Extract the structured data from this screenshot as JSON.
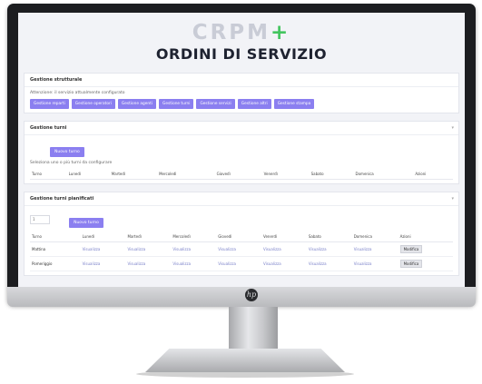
{
  "app": {
    "logo_text": "CRPM",
    "logo_plus": "+",
    "title": "ORDINI DI SERVIZIO"
  },
  "colors": {
    "accent": "#8b7ff0",
    "logo_grey": "#c9ccd6",
    "logo_plus": "#43c55f",
    "title": "#1e2230"
  },
  "section_structure": {
    "heading": "Gestione strutturale",
    "note": "Attenzione: il servizio attualmente configurato",
    "buttons": [
      "Gestione reparti",
      "Gestione operatori",
      "Gestione agenti",
      "Gestione turni",
      "Gestione servizi",
      "Gestione altri",
      "Gestione stampa"
    ]
  },
  "section_shifts": {
    "heading": "Gestione turni",
    "new_button": "Nuovo turno",
    "note": "Seleziona uno o più turni da configurare",
    "columns": [
      "Turno",
      "Lunedì",
      "Martedì",
      "Mercoledì",
      "Giovedì",
      "Venerdì",
      "Sabato",
      "Domenica",
      "Azioni"
    ]
  },
  "section_planned": {
    "heading": "Gestione turni pianificati",
    "select_value": "1",
    "new_button": "Nuovo turno",
    "columns": [
      "Turno",
      "Lunedì",
      "Martedì",
      "Mercoledì",
      "Giovedì",
      "Venerdì",
      "Sabato",
      "Domenica",
      "Azioni"
    ],
    "rows": [
      {
        "shift": "Mattina",
        "cells": [
          "Visualizza",
          "Visualizza",
          "Visualizza",
          "Visualizza",
          "Visualizza",
          "Visualizza",
          "Visualizza"
        ],
        "action": "Modifica"
      },
      {
        "shift": "Pomeriggio",
        "cells": [
          "Visualizza",
          "Visualizza",
          "Visualizza",
          "Visualizza",
          "Visualizza",
          "Visualizza",
          "Visualizza"
        ],
        "action": "Modifica"
      }
    ]
  }
}
